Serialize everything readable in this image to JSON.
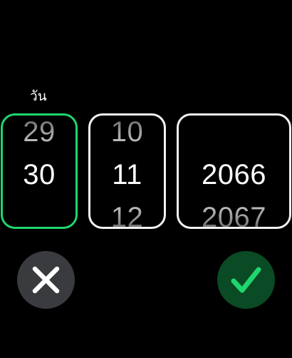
{
  "day_field": {
    "label": "วัน",
    "prev": "29",
    "selected": "30",
    "next": ""
  },
  "month_field": {
    "prev": "10",
    "selected": "11",
    "next": "12"
  },
  "year_field": {
    "prev": "",
    "selected": "2066",
    "next": "2067"
  },
  "buttons": {
    "cancel_icon": "close-icon",
    "confirm_icon": "checkmark-icon"
  },
  "colors": {
    "focus_border": "#1fd66d",
    "confirm_bg": "#0a4a24",
    "confirm_check": "#1fd66d",
    "cancel_bg": "#3a3b3e"
  }
}
